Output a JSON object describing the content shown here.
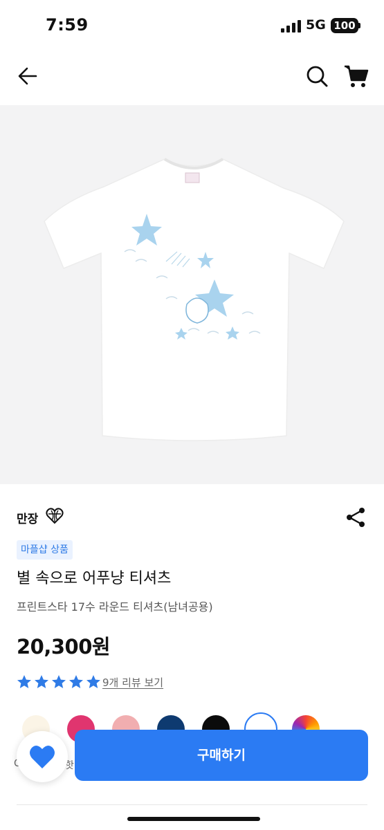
{
  "status_bar": {
    "time": "7:59",
    "network": "5G",
    "battery": "100"
  },
  "nav": {
    "back_icon": "arrow-left-icon",
    "search_icon": "search-icon",
    "cart_icon": "cart-icon"
  },
  "product": {
    "seller": "만장",
    "seller_badge_icon": "heart-globe-badge-icon",
    "tag": "마플샵 상품",
    "title": "별 속으로 어푸냥 티셔츠",
    "subtitle": "프린트스타 17수 라운드 티셔츠(남녀공용)",
    "price": "20,300원",
    "rating": 5,
    "rating_max": 5,
    "review_link": "9개 리뷰 보기"
  },
  "colors": {
    "accent": "#2b7bf3",
    "star": "#2f7be6",
    "swatches": [
      "#fbf4e6",
      "#e0356f",
      "#f1aeb0",
      "#0e3a70",
      "#0b0b0b",
      "#ffffff",
      "rainbow"
    ]
  },
  "hints": {
    "left": "C",
    "right": "핫"
  },
  "actions": {
    "like_icon": "heart-icon",
    "buy_label": "구매하기"
  }
}
